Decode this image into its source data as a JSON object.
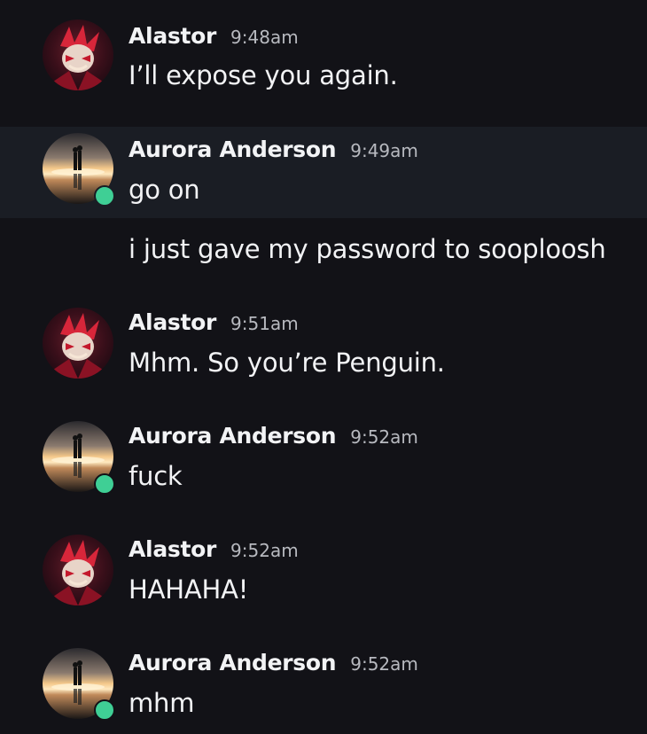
{
  "colors": {
    "background": "#121217",
    "highlight_row": "#1a1d24",
    "online_status": "#3fcf95",
    "timestamp": "#b7b9bf"
  },
  "messages": [
    {
      "author": "Alastor",
      "time": "9:48am",
      "text": "I’ll expose you again.",
      "avatar": "alastor-avatar"
    },
    {
      "author": "Aurora Anderson",
      "time": "9:49am",
      "text": "go on",
      "avatar": "sunset-couple-avatar",
      "online": true
    },
    {
      "text": "i just gave my password to sooploosh"
    },
    {
      "author": "Alastor",
      "time": "9:51am",
      "text": "Mhm. So you’re Penguin.",
      "avatar": "alastor-avatar"
    },
    {
      "author": "Aurora Anderson",
      "time": "9:52am",
      "text": "fuck",
      "avatar": "sunset-couple-avatar",
      "online": true
    },
    {
      "author": "Alastor",
      "time": "9:52am",
      "text": "HAHAHA!",
      "avatar": "alastor-avatar"
    },
    {
      "author": "Aurora Anderson",
      "time": "9:52am",
      "text": "mhm",
      "avatar": "sunset-couple-avatar",
      "online": true
    }
  ]
}
